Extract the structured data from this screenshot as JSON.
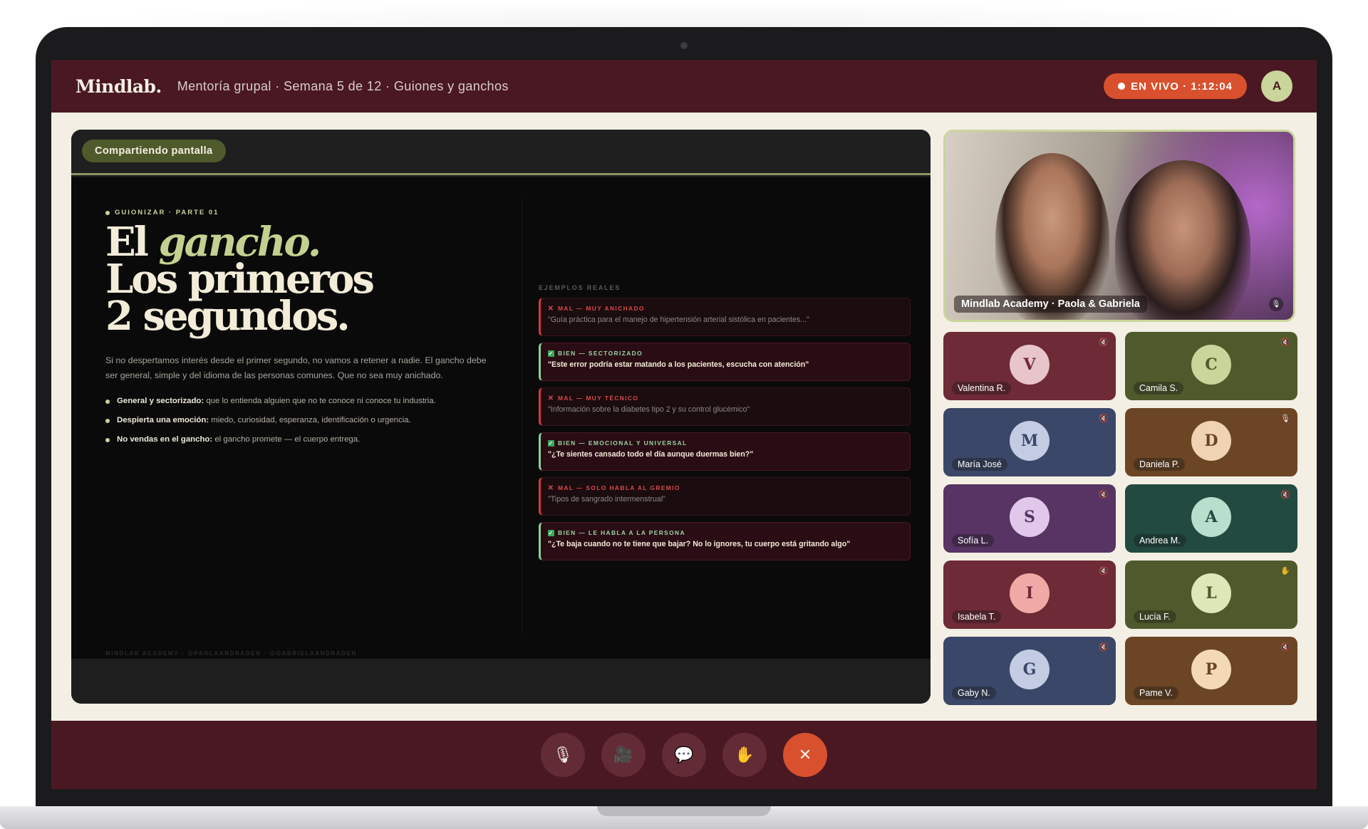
{
  "app": {
    "logo": "Mindlab.",
    "meeting_title": "Mentoría grupal · Semana 5 de 12 · Guiones y ganchos",
    "live_label": "EN VIVO · 1:12:04",
    "user_initial": "A"
  },
  "share": {
    "chip_label": "Compartiendo pantalla",
    "slide": {
      "kicker": "GUIONIZAR · PARTE 01",
      "headline_line1_start": "El ",
      "headline_line1_accent": "gancho.",
      "headline_line2": "Los primeros",
      "headline_line3": "2 segundos.",
      "lead": "Si no despertamos interés desde el primer segundo, no vamos a retener a nadie. El gancho debe ser general, simple y del idioma de las personas comunes. Que no sea muy anichado.",
      "bullets": [
        {
          "bold": "General y sectorizado:",
          "text": " que lo entienda alguien que no te conoce ni conoce tu industria."
        },
        {
          "bold": "Despierta una emoción:",
          "text": " miedo, curiosidad, esperanza, identificación o urgencia."
        },
        {
          "bold": "No vendas en el gancho:",
          "text": " el gancho promete — el cuerpo entrega."
        }
      ],
      "footer": "MINDLAB ACADEMY · @PAOLAANDRADEN · @GABRIELAANDRADEN",
      "examples_title": "EJEMPLOS REALES",
      "examples": [
        {
          "type": "bad",
          "tag": "MAL — MUY ANICHADO",
          "text": "\"Guía práctica para el manejo de hipertensión arterial sistólica en pacientes...\""
        },
        {
          "type": "good",
          "tag": "BIEN — SECTORIZADO",
          "text": "\"Este error podría estar matando a los pacientes, escucha con atención\""
        },
        {
          "type": "bad",
          "tag": "MAL — MUY TÉCNICO",
          "text": "\"Información sobre la diabetes tipo 2 y su control glucémico\""
        },
        {
          "type": "good",
          "tag": "BIEN — EMOCIONAL Y UNIVERSAL",
          "text": "\"¿Te sientes cansado todo el día aunque duermas bien?\""
        },
        {
          "type": "bad",
          "tag": "MAL — SOLO HABLA AL GREMIO",
          "text": "\"Tipos de sangrado intermenstrual\""
        },
        {
          "type": "good",
          "tag": "BIEN — LE HABLA A LA PERSONA",
          "text": "\"¿Te baja cuando no te tiene que bajar? No lo ignores, tu cuerpo está gritando algo\""
        }
      ]
    }
  },
  "host": {
    "label": "Mindlab Academy · Paola & Gabriela",
    "mic_icon": "mic-icon"
  },
  "participants": [
    {
      "name": "Valentina R.",
      "initial": "V",
      "bg": "#6e2a36",
      "avatar_bg": "#e8c4cb",
      "avatar_fg": "#6e2a36",
      "icon": "muted-icon",
      "glyph": "🔇"
    },
    {
      "name": "Camila S.",
      "initial": "C",
      "bg": "#4f5a2c",
      "avatar_bg": "#c9d59a",
      "avatar_fg": "#4f5a2c",
      "icon": "muted-icon",
      "glyph": "🔇"
    },
    {
      "name": "María José",
      "initial": "M",
      "bg": "#3b4768",
      "avatar_bg": "#c3cce3",
      "avatar_fg": "#3b4768",
      "icon": "muted-icon",
      "glyph": "🔇"
    },
    {
      "name": "Daniela P.",
      "initial": "D",
      "bg": "#6b4524",
      "avatar_bg": "#f0d3b2",
      "avatar_fg": "#6b4524",
      "icon": "mic-icon",
      "glyph": "🎙"
    },
    {
      "name": "Sofía L.",
      "initial": "S",
      "bg": "#573463",
      "avatar_bg": "#e1c8ea",
      "avatar_fg": "#573463",
      "icon": "muted-icon",
      "glyph": "🔇"
    },
    {
      "name": "Andrea M.",
      "initial": "A",
      "bg": "#234a40",
      "avatar_bg": "#b8decd",
      "avatar_fg": "#234a40",
      "icon": "muted-icon",
      "glyph": "🔇"
    },
    {
      "name": "Isabela T.",
      "initial": "I",
      "bg": "#6e2a36",
      "avatar_bg": "#f0a9a5",
      "avatar_fg": "#6e2a36",
      "icon": "muted-icon",
      "glyph": "🔇"
    },
    {
      "name": "Lucía F.",
      "initial": "L",
      "bg": "#4f5a2c",
      "avatar_bg": "#dde7b8",
      "avatar_fg": "#4f5a2c",
      "icon": "raised-hand-icon",
      "glyph": "✋"
    },
    {
      "name": "Gaby N.",
      "initial": "G",
      "bg": "#3b4768",
      "avatar_bg": "#c3cce3",
      "avatar_fg": "#3b4768",
      "icon": "muted-icon",
      "glyph": "🔇"
    },
    {
      "name": "Pame V.",
      "initial": "P",
      "bg": "#6b4524",
      "avatar_bg": "#f3d9b6",
      "avatar_fg": "#6b4524",
      "icon": "muted-icon",
      "glyph": "🔇"
    }
  ],
  "controls": [
    {
      "name": "mic-button",
      "icon": "mic-icon",
      "glyph": "🎙"
    },
    {
      "name": "camera-button",
      "icon": "camera-icon",
      "glyph": "🎥"
    },
    {
      "name": "chat-button",
      "icon": "chat-icon",
      "glyph": "💬"
    },
    {
      "name": "raise-hand-button",
      "icon": "raised-hand-icon",
      "glyph": "✋"
    },
    {
      "name": "leave-call-button",
      "icon": "close-icon",
      "glyph": "✕"
    }
  ]
}
